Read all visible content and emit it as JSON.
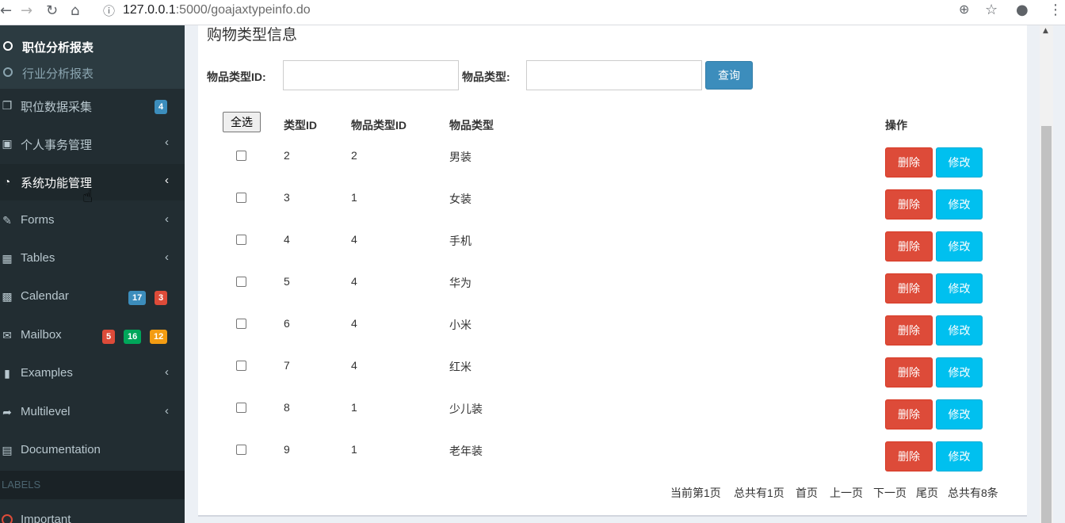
{
  "browser": {
    "url_host": "127.0.0.1",
    "url_rest": ":5000/goajaxtypeinfo.do"
  },
  "sidebar": {
    "sub_items": [
      {
        "label": "职位分析报表",
        "active": true
      },
      {
        "label": "行业分析报表",
        "active": false
      }
    ],
    "items": [
      {
        "label": "职位数据采集",
        "icon": "copy-icon",
        "badges": [
          {
            "text": "4",
            "color": "#3c8dbc"
          }
        ]
      },
      {
        "label": "个人事务管理",
        "icon": "laptop-icon"
      },
      {
        "label": "系统功能管理",
        "icon": "pie-chart-icon"
      },
      {
        "label": "Forms",
        "icon": "edit-icon"
      },
      {
        "label": "Tables",
        "icon": "table-icon"
      },
      {
        "label": "Calendar",
        "icon": "calendar-icon",
        "badges": [
          {
            "text": "17",
            "color": "#3c8dbc"
          },
          {
            "text": "3",
            "color": "#dd4b39"
          }
        ]
      },
      {
        "label": "Mailbox",
        "icon": "envelope-icon",
        "badges": [
          {
            "text": "5",
            "color": "#dd4b39"
          },
          {
            "text": "16",
            "color": "#00a65a"
          },
          {
            "text": "12",
            "color": "#f39c12"
          }
        ]
      },
      {
        "label": "Examples",
        "icon": "folder-icon"
      },
      {
        "label": "Multilevel",
        "icon": "share-icon"
      },
      {
        "label": "Documentation",
        "icon": "book-icon"
      }
    ],
    "labels_header": "LABELS",
    "important_label": "Important"
  },
  "main": {
    "title": "购物类型信息",
    "search": {
      "type_id_label": "物品类型ID:",
      "type_label": "物品类型:",
      "query_button": "查询"
    },
    "table": {
      "select_all": "全选",
      "headers": {
        "type_id": "类型ID",
        "item_type_id": "物品类型ID",
        "item_type": "物品类型",
        "actions": "操作"
      },
      "rows": [
        {
          "type_id": "2",
          "item_type_id": "2",
          "item_type": "男装"
        },
        {
          "type_id": "3",
          "item_type_id": "1",
          "item_type": "女装"
        },
        {
          "type_id": "4",
          "item_type_id": "4",
          "item_type": "手机"
        },
        {
          "type_id": "5",
          "item_type_id": "4",
          "item_type": "华为"
        },
        {
          "type_id": "6",
          "item_type_id": "4",
          "item_type": "小米"
        },
        {
          "type_id": "7",
          "item_type_id": "4",
          "item_type": "红米"
        },
        {
          "type_id": "8",
          "item_type_id": "1",
          "item_type": "少儿装"
        },
        {
          "type_id": "9",
          "item_type_id": "1",
          "item_type": "老年装"
        }
      ],
      "delete_label": "删除",
      "edit_label": "修改"
    },
    "pager": {
      "current": "当前第1页",
      "total_pages": "总共有1页",
      "first": "首页",
      "prev": "上一页",
      "next": "下一页",
      "last": "尾页",
      "total_records": "总共有8条"
    }
  }
}
